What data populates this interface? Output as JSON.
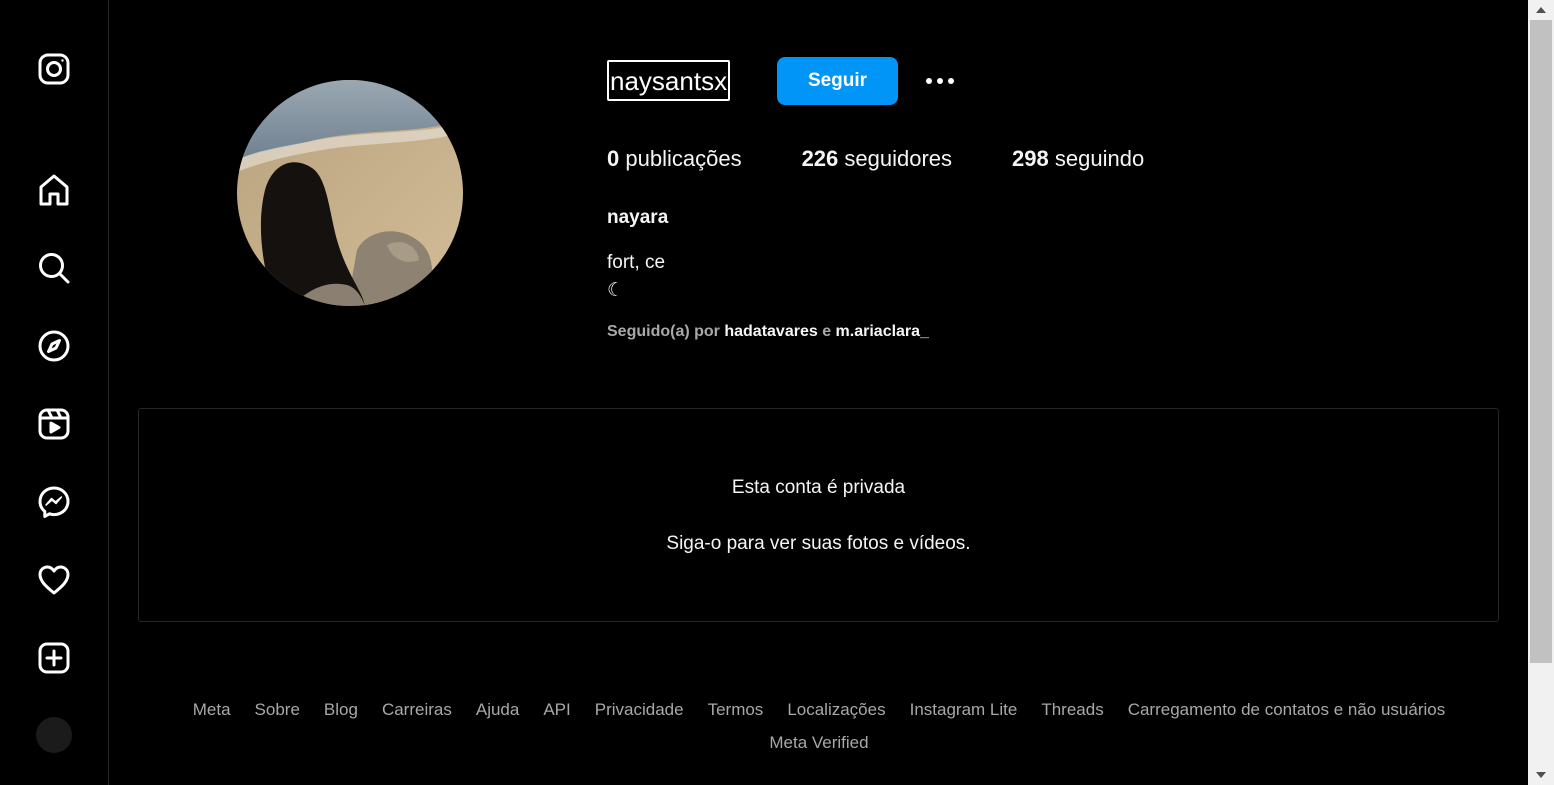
{
  "sidebar": {
    "items": [
      {
        "name": "instagram-logo-icon"
      },
      {
        "name": "home-icon"
      },
      {
        "name": "search-icon"
      },
      {
        "name": "explore-icon"
      },
      {
        "name": "reels-icon"
      },
      {
        "name": "messenger-icon"
      },
      {
        "name": "heart-icon"
      },
      {
        "name": "create-icon"
      }
    ]
  },
  "profile": {
    "username": "naysantsx",
    "follow_label": "Seguir",
    "stats": {
      "posts_count": "0",
      "posts_label": "publicações",
      "followers_count": "226",
      "followers_label": "seguidores",
      "following_count": "298",
      "following_label": "seguindo"
    },
    "full_name": "nayara",
    "bio_line1": "fort, ce",
    "bio_line2": "☾",
    "followed_by_prefix": "Seguido(a) por",
    "followed_by_user1": "hadatavares",
    "followed_by_conj": "e",
    "followed_by_user2": "m.ariaclara_"
  },
  "private_notice": {
    "title": "Esta conta é privada",
    "subtitle": "Siga-o para ver suas fotos e vídeos."
  },
  "footer": {
    "links": [
      "Meta",
      "Sobre",
      "Blog",
      "Carreiras",
      "Ajuda",
      "API",
      "Privacidade",
      "Termos",
      "Localizações",
      "Instagram Lite",
      "Threads",
      "Carregamento de contatos e não usuários"
    ],
    "line2": "Meta Verified"
  },
  "colors": {
    "accent": "#0095f6",
    "background": "#000000",
    "secondary_text": "#a8a8a8"
  }
}
